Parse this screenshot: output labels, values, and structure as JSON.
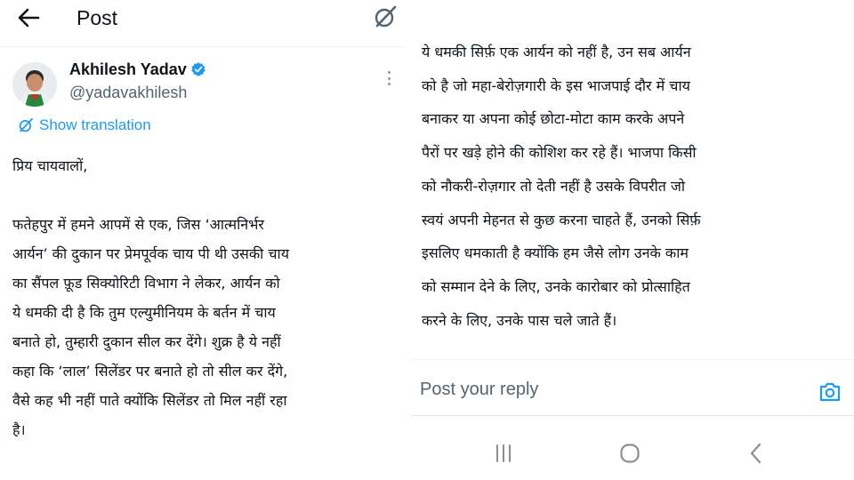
{
  "header": {
    "title": "Post",
    "back_icon": "arrow-left-icon",
    "grok_icon": "grok-icon"
  },
  "author": {
    "name": "Akhilesh Yadav",
    "handle": "@yadavakhilesh",
    "verified": true
  },
  "translate": {
    "label": "Show translation"
  },
  "post": {
    "greeting": "प्रिय चायवालों,",
    "lines": [
      "फतेहपुर में हमने आपमें से एक, जिस ‘आत्मनिर्भर",
      "आर्यन’ की दुकान पर प्रेमपूर्वक चाय पी थी उसकी चाय",
      "का सैंपल फ़ूड सिक्योरिटी विभाग ने लेकर, आर्यन को",
      "ये धमकी दी है कि तुम एल्युमीनियम के बर्तन में चाय",
      "बनाते हो, तुम्हारी दुकान सील कर देंगे। शुक्र है ये नहीं",
      "कहा कि ‘लाल’ सिलेंडर पर बनाते हो तो सील कर देंगे,",
      "वैसे कह भी नहीं पाते क्योंकि सिलेंडर तो मिल नहीं रहा",
      "है।"
    ],
    "continued_lines": [
      "ये धमकी सिर्फ़ एक आर्यन को नहीं है, उन सब आर्यन",
      "को है जो महा-बेरोज़गारी के इस भाजपाई दौर में चाय",
      "बनाकर या अपना कोई छोटा-मोटा काम करके अपने",
      "पैरों पर खड़े होने की कोशिश कर रहे हैं। भाजपा किसी",
      "को नौकरी-रोज़गार तो देती नहीं है उसके विपरीत जो",
      "स्वयं अपनी मेहनत से कुछ करना चाहते हैं, उनको सिर्फ़",
      "इसलिए धमकाती है क्योंकि हम जैसे लोग उनके काम",
      "को सम्मान देने के लिए, उनके कारोबार को प्रोत्साहित",
      "करने के लिए, उनके पास चले जाते हैं।"
    ]
  },
  "reply": {
    "placeholder": "Post your reply",
    "camera_icon": "camera-icon"
  },
  "navbar": {
    "recents_icon": "recent-apps-icon",
    "home_icon": "home-icon",
    "back_icon": "nav-back-icon"
  },
  "colors": {
    "accent": "#1d9bf0",
    "secondary_text": "#536471",
    "primary_text": "#0f1419",
    "divider": "#eff3f4"
  }
}
